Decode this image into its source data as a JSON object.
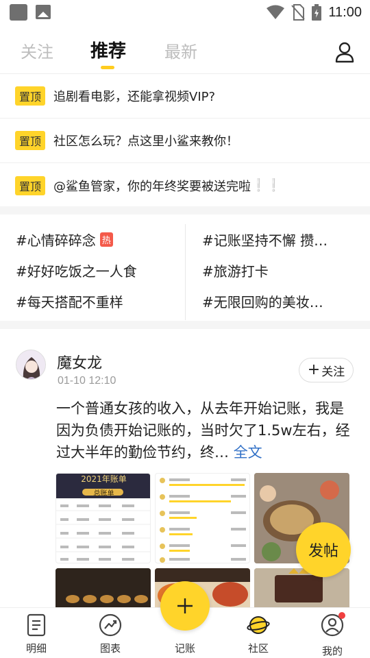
{
  "status_bar": {
    "time": "11:00",
    "icons": [
      "app-icon",
      "image-icon",
      "wifi-icon",
      "no-sim-icon",
      "battery-icon"
    ]
  },
  "tabs": [
    {
      "label": "关注",
      "active": false
    },
    {
      "label": "推荐",
      "active": true
    },
    {
      "label": "最新",
      "active": false
    }
  ],
  "pinned": {
    "badge": "置顶",
    "items": [
      {
        "text": "追剧看电影，还能拿视频VIP?",
        "suffix": ""
      },
      {
        "text": "社区怎么玩？点这里小鲨来教你！",
        "suffix": ""
      },
      {
        "text": "@鲨鱼管家，你的年终奖要被送完啦",
        "suffix": "❕❕"
      }
    ]
  },
  "topics": {
    "hot_badge": "热",
    "items": [
      {
        "label": "#心情碎碎念",
        "hot": true
      },
      {
        "label": "#记账坚持不懈 攒…",
        "hot": false
      },
      {
        "label": "#好好吃饭之一人食",
        "hot": false
      },
      {
        "label": "#旅游打卡",
        "hot": false
      },
      {
        "label": "#每天搭配不重样",
        "hot": false
      },
      {
        "label": "#无限回购的美妆…",
        "hot": false
      }
    ]
  },
  "post": {
    "username": "魔女龙",
    "time": "01-10 12:10",
    "follow_label": "关注",
    "body": "一个普通女孩的收入，从去年开始记账，我是因为负债开始记账的，当时欠了1.5w左右，经过大半年的勤俭节约，终…",
    "more_label": "全文",
    "thumb1_title": "2021年账单",
    "thumb1_subtitle": "总账单"
  },
  "fab_post_label": "发帖",
  "bottom_nav": [
    {
      "label": "明细",
      "icon": "document-icon"
    },
    {
      "label": "图表",
      "icon": "chart-icon"
    },
    {
      "label": "记账",
      "icon": "plus-icon"
    },
    {
      "label": "社区",
      "icon": "planet-icon"
    },
    {
      "label": "我的",
      "icon": "user-icon"
    }
  ],
  "colors": {
    "accent": "#ffd42a",
    "hot_badge": "#f45a4a",
    "link": "#2f6fc6"
  }
}
